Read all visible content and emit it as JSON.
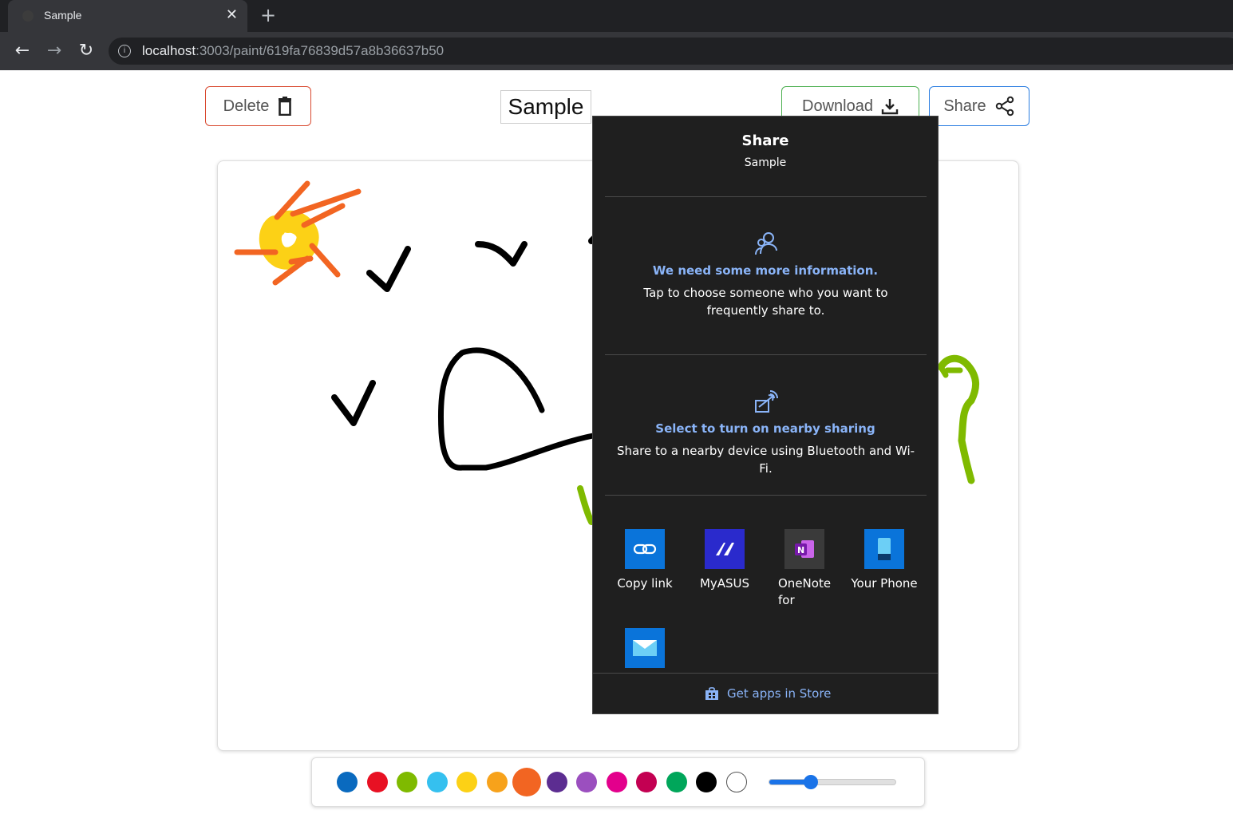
{
  "browser": {
    "tab_title": "Sample",
    "url_host": "localhost",
    "url_rest": ":3003/paint/619fa76839d57a8b36637b50"
  },
  "header": {
    "delete_label": "Delete",
    "title_value": "Sample",
    "download_label": "Download",
    "share_label": "Share"
  },
  "share_panel": {
    "title": "Share",
    "subtitle": "Sample",
    "info_heading": "We need some more information.",
    "info_text": "Tap to choose someone who you want to frequently share to.",
    "nearby_heading": "Select to turn on nearby sharing",
    "nearby_text": "Share to a nearby device using Bluetooth and Wi-Fi.",
    "apps": [
      {
        "label": "Copy link",
        "icon": "copy-link-icon"
      },
      {
        "label": "MyASUS",
        "icon": "myasus-icon"
      },
      {
        "label": "OneNote for Windo",
        "icon": "onenote-icon"
      },
      {
        "label": "Your Phone",
        "icon": "your-phone-icon"
      },
      {
        "label": "",
        "icon": "mail-icon"
      }
    ],
    "store_label": "Get apps in Store"
  },
  "palette": {
    "colors": [
      "#0a6abf",
      "#e81123",
      "#7fba00",
      "#35c0ef",
      "#fcd116",
      "#f7a21b",
      "#f26522",
      "#5c2d91",
      "#9b4fbf",
      "#e3008c",
      "#c30052",
      "#00a65a",
      "#000000",
      "#ffffff"
    ],
    "selected_color": "#f26522",
    "brush_size_fraction": 0.33
  }
}
